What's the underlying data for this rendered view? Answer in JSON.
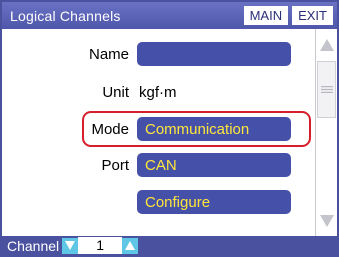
{
  "titlebar": {
    "title": "Logical Channels",
    "main_label": "MAIN",
    "exit_label": "EXIT"
  },
  "fields": {
    "name": {
      "label": "Name",
      "value": ""
    },
    "unit": {
      "label": "Unit",
      "value": "kgf·m"
    },
    "mode": {
      "label": "Mode",
      "value": "Communication"
    },
    "port": {
      "label": "Port",
      "value": "CAN"
    },
    "configure": {
      "label": "Configure"
    }
  },
  "bottombar": {
    "channel_label": "Channel",
    "channel_value": "1"
  },
  "colors": {
    "frame": "#4a52a0",
    "field_bg": "#4550a8",
    "field_text": "#ffe63a",
    "highlight": "#d61f2a",
    "arrow": "#5fc6e6"
  },
  "icons": {
    "scroll_up": "triangle-up-icon",
    "scroll_down": "triangle-down-icon",
    "thumb_grip": "grip-lines-icon",
    "channel_down": "triangle-down-icon",
    "channel_up": "triangle-up-icon"
  }
}
